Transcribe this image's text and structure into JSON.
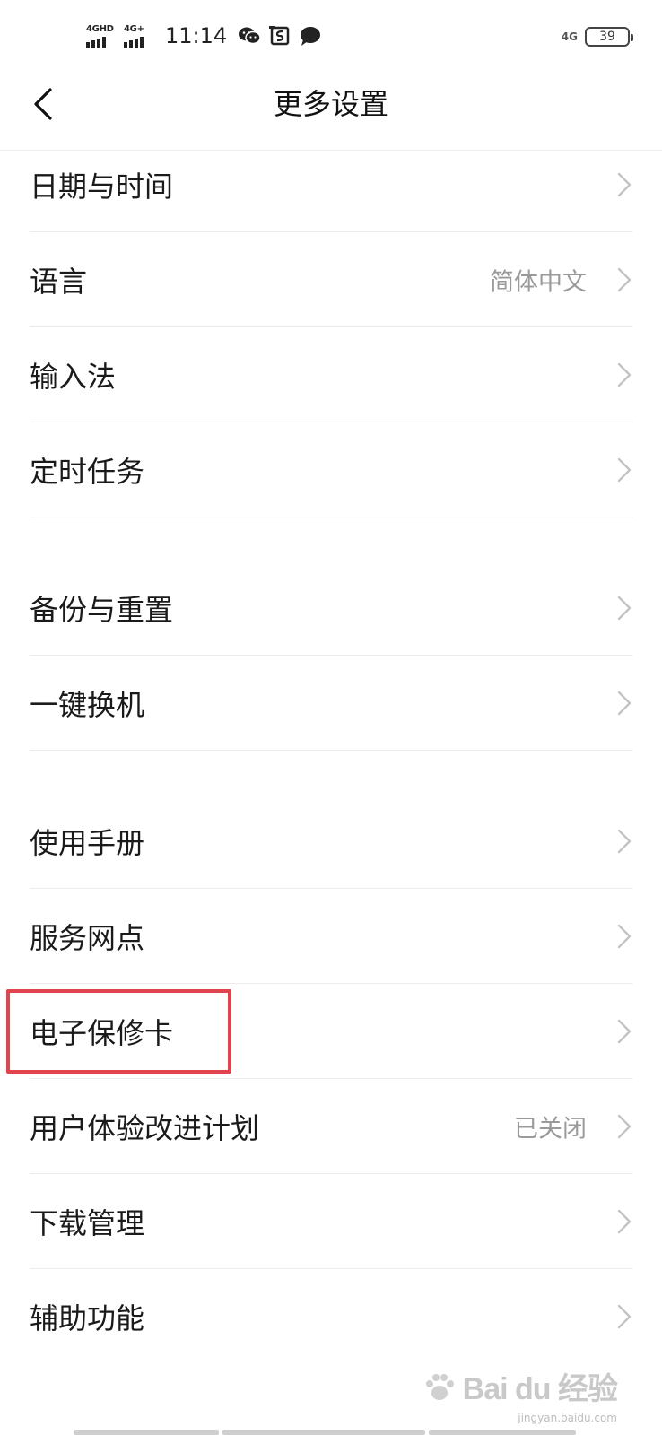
{
  "status_bar": {
    "sim1_label": "4GHD",
    "sim2_label": "4G+",
    "time": "11:14",
    "network_label": "4G",
    "battery": "39",
    "icons": [
      "wechat-icon",
      "screenshot-icon",
      "message-icon"
    ]
  },
  "header": {
    "title": "更多设置",
    "back_icon": "chevron-left-icon"
  },
  "groups": [
    {
      "items": [
        {
          "label": "日期与时间",
          "value": ""
        },
        {
          "label": "语言",
          "value": "简体中文"
        },
        {
          "label": "输入法",
          "value": ""
        },
        {
          "label": "定时任务",
          "value": ""
        }
      ]
    },
    {
      "items": [
        {
          "label": "备份与重置",
          "value": ""
        },
        {
          "label": "一键换机",
          "value": ""
        }
      ]
    },
    {
      "items": [
        {
          "label": "使用手册",
          "value": ""
        },
        {
          "label": "服务网点",
          "value": ""
        },
        {
          "label": "电子保修卡",
          "value": ""
        },
        {
          "label": "用户体验改进计划",
          "value": "已关闭"
        },
        {
          "label": "下载管理",
          "value": ""
        },
        {
          "label": "辅助功能",
          "value": ""
        }
      ]
    }
  ],
  "highlight_color": "#e0444d",
  "watermark": {
    "text": "Bai du 经验",
    "sub": "jingyan.baidu.com"
  }
}
